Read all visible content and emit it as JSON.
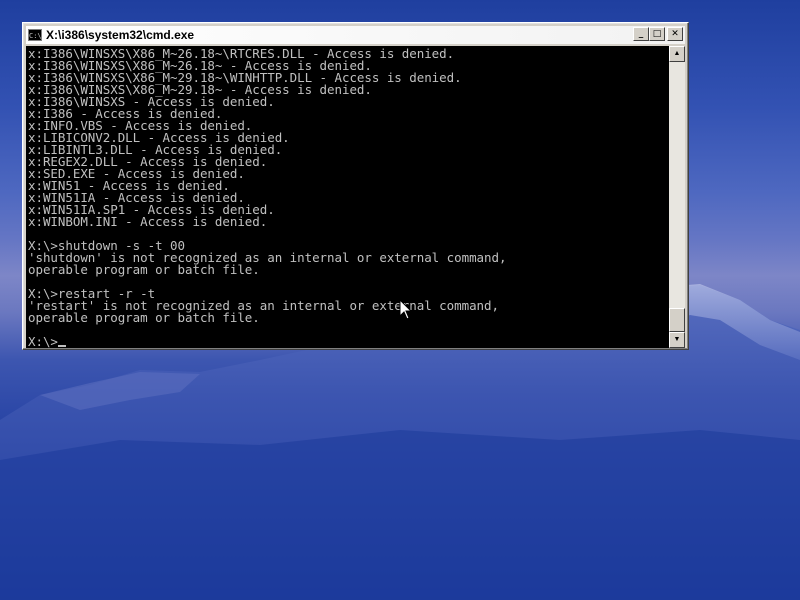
{
  "window": {
    "title": "X:\\i386\\system32\\cmd.exe",
    "icon_label": "C:\\",
    "buttons": {
      "minimize": "_",
      "maximize": "□",
      "close": "✕"
    }
  },
  "console": {
    "lines": [
      "x:I386\\WINSXS\\X86_M~26.18~\\RTCRES.DLL - Access is denied.",
      "x:I386\\WINSXS\\X86_M~26.18~ - Access is denied.",
      "x:I386\\WINSXS\\X86_M~29.18~\\WINHTTP.DLL - Access is denied.",
      "x:I386\\WINSXS\\X86_M~29.18~ - Access is denied.",
      "x:I386\\WINSXS - Access is denied.",
      "x:I386 - Access is denied.",
      "x:INFO.VBS - Access is denied.",
      "x:LIBICONV2.DLL - Access is denied.",
      "x:LIBINTL3.DLL - Access is denied.",
      "x:REGEX2.DLL - Access is denied.",
      "x:SED.EXE - Access is denied.",
      "x:WIN51 - Access is denied.",
      "x:WIN51IA - Access is denied.",
      "x:WIN51IA.SP1 - Access is denied.",
      "x:WINBOM.INI - Access is denied.",
      "",
      "X:\\>shutdown -s -t 00",
      "'shutdown' is not recognized as an internal or external command,",
      "operable program or batch file.",
      "",
      "X:\\>restart -r -t",
      "'restart' is not recognized as an internal or external command,",
      "operable program or batch file.",
      ""
    ],
    "prompt": "X:\\>"
  },
  "scrollbar": {
    "up_arrow": "▲",
    "down_arrow": "▼"
  },
  "colors": {
    "console_bg": "#000000",
    "console_fg": "#c0c0c0",
    "window_frame": "#d4d0c8",
    "desktop_blue": "#2a46a6"
  },
  "icons": {
    "window_icon": "cmd-console-icon",
    "pointer": "arrow-cursor-icon"
  }
}
